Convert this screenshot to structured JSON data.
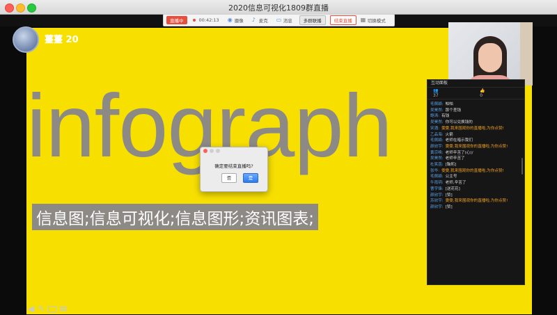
{
  "window": {
    "title": "2020信息可视化1809群直播"
  },
  "toolbar": {
    "live_badge": "直播中",
    "timer": "00:42:13",
    "items": [
      {
        "label": "摄像",
        "icon": "camera-icon"
      },
      {
        "label": "麦克",
        "icon": "mic-icon"
      },
      {
        "label": "消息",
        "icon": "message-icon"
      }
    ],
    "multi_group": "多群联播",
    "end_live": "结束直播",
    "switch_mode": "切换模式"
  },
  "host": {
    "name": "薹薹 20"
  },
  "slide": {
    "word": "infograph",
    "subtitle": "信息图;信息可视化;信息图形;资讯图表;"
  },
  "chat": {
    "title": "互动面板",
    "viewers": "37",
    "likes": "0",
    "messages": [
      {
        "user": "毛佩颖:",
        "text": "帕帕",
        "highlight": false
      },
      {
        "user": "吴昊然:",
        "text": "那个差钱",
        "highlight": false
      },
      {
        "user": "鲍涛:",
        "text": "有钱",
        "highlight": false
      },
      {
        "user": "吴昊然:",
        "text": "你可以兑换钱的",
        "highlight": false
      },
      {
        "user": "宋涌:",
        "text": "雯雯,我来围观你的直播啦,为你点赞!",
        "highlight": true
      },
      {
        "user": "乙品海:",
        "text": "火箭",
        "highlight": false
      },
      {
        "user": "毛佩颖:",
        "text": "老师在暗示我们",
        "highlight": false
      },
      {
        "user": "颜欣宇:",
        "text": "雯雯,我来围观你的直播啦,为你点赞!",
        "highlight": true
      },
      {
        "user": "黄宗唤:",
        "text": "老师辛苦了(心)/",
        "highlight": false
      },
      {
        "user": "吴昊然:",
        "text": "老师辛苦了",
        "highlight": false
      },
      {
        "user": "杜笑菡:",
        "text": "[鞠躬]",
        "highlight": false
      },
      {
        "user": "张华:",
        "text": "雯雯,我来围观你的直播啦,为你点赞!",
        "highlight": true
      },
      {
        "user": "毛佩颖:",
        "text": "公主号",
        "highlight": false
      },
      {
        "user": "牛雨玥:",
        "text": "老师,辛苦了",
        "highlight": false
      },
      {
        "user": "曹宇锋:",
        "text": "[送花花]",
        "highlight": false
      },
      {
        "user": "颜欣宇:",
        "text": "[赞]",
        "highlight": false
      },
      {
        "user": "苏欣宇:",
        "text": "雯雯,我来围观你的直播啦,为你点赞!",
        "highlight": true
      },
      {
        "user": "颜欣宇:",
        "text": "[赞]",
        "highlight": false
      }
    ]
  },
  "dialog": {
    "message": "确定要结束直播吗?",
    "no_label": "否",
    "yes_label": "是"
  }
}
